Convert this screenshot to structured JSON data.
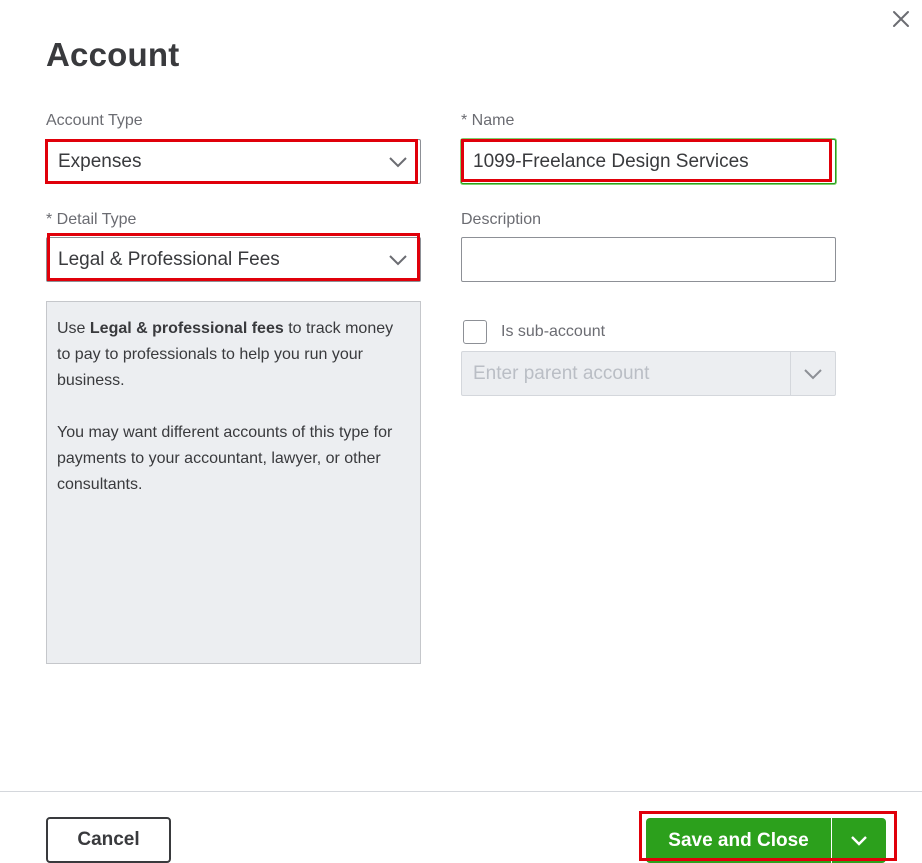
{
  "dialog": {
    "title": "Account"
  },
  "account_type": {
    "label": "Account Type",
    "value": "Expenses"
  },
  "name": {
    "label": "* Name",
    "value": "1099-Freelance Design Services"
  },
  "detail_type": {
    "label": "* Detail Type",
    "value": "Legal & Professional Fees"
  },
  "description": {
    "label": "Description",
    "value": ""
  },
  "info": {
    "p1_prefix": "Use ",
    "p1_bold": "Legal & professional fees",
    "p1_suffix": " to track money to pay to professionals to help you run your business.",
    "p2": "You may want different accounts of this type for payments to your accountant, lawyer, or other consultants."
  },
  "sub_account": {
    "label": "Is sub-account",
    "checked": false,
    "parent_placeholder": "Enter parent account"
  },
  "footer": {
    "cancel_label": "Cancel",
    "save_label": "Save and Close"
  },
  "colors": {
    "highlight": "#e0000a",
    "primary": "#2ca01c"
  },
  "icons": {
    "close": "close-icon",
    "dropdown": "chevron-down-icon"
  }
}
